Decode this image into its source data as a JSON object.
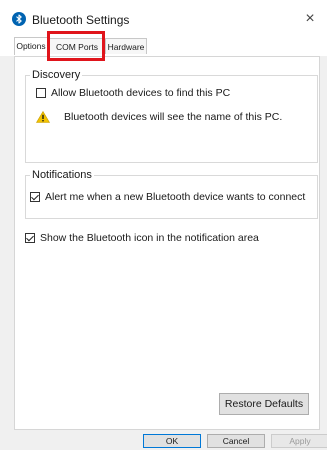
{
  "window": {
    "title": "Bluetooth Settings",
    "close_glyph": "×"
  },
  "tabs": [
    {
      "label": "Options",
      "active": true
    },
    {
      "label": "COM Ports",
      "active": false,
      "highlighted": true
    },
    {
      "label": "Hardware",
      "active": false
    }
  ],
  "discovery": {
    "group_label": "Discovery",
    "allow_label": "Allow Bluetooth devices to find this PC",
    "allow_checked": false,
    "warning_text": "Bluetooth devices will see the name of this PC."
  },
  "notifications": {
    "group_label": "Notifications",
    "alert_label": "Alert me when a new Bluetooth device wants to connect",
    "alert_checked": true
  },
  "show_icon": {
    "label": "Show the Bluetooth icon in the notification area",
    "checked": true
  },
  "buttons": {
    "restore": "Restore Defaults",
    "ok": "OK",
    "cancel": "Cancel",
    "apply": "Apply"
  },
  "colors": {
    "highlight": "#e0141b",
    "bluetooth": "#0063b1",
    "warning": "#f2c200"
  },
  "icons": {
    "title": "bluetooth-icon",
    "warning": "warning-icon",
    "close": "close-icon"
  }
}
